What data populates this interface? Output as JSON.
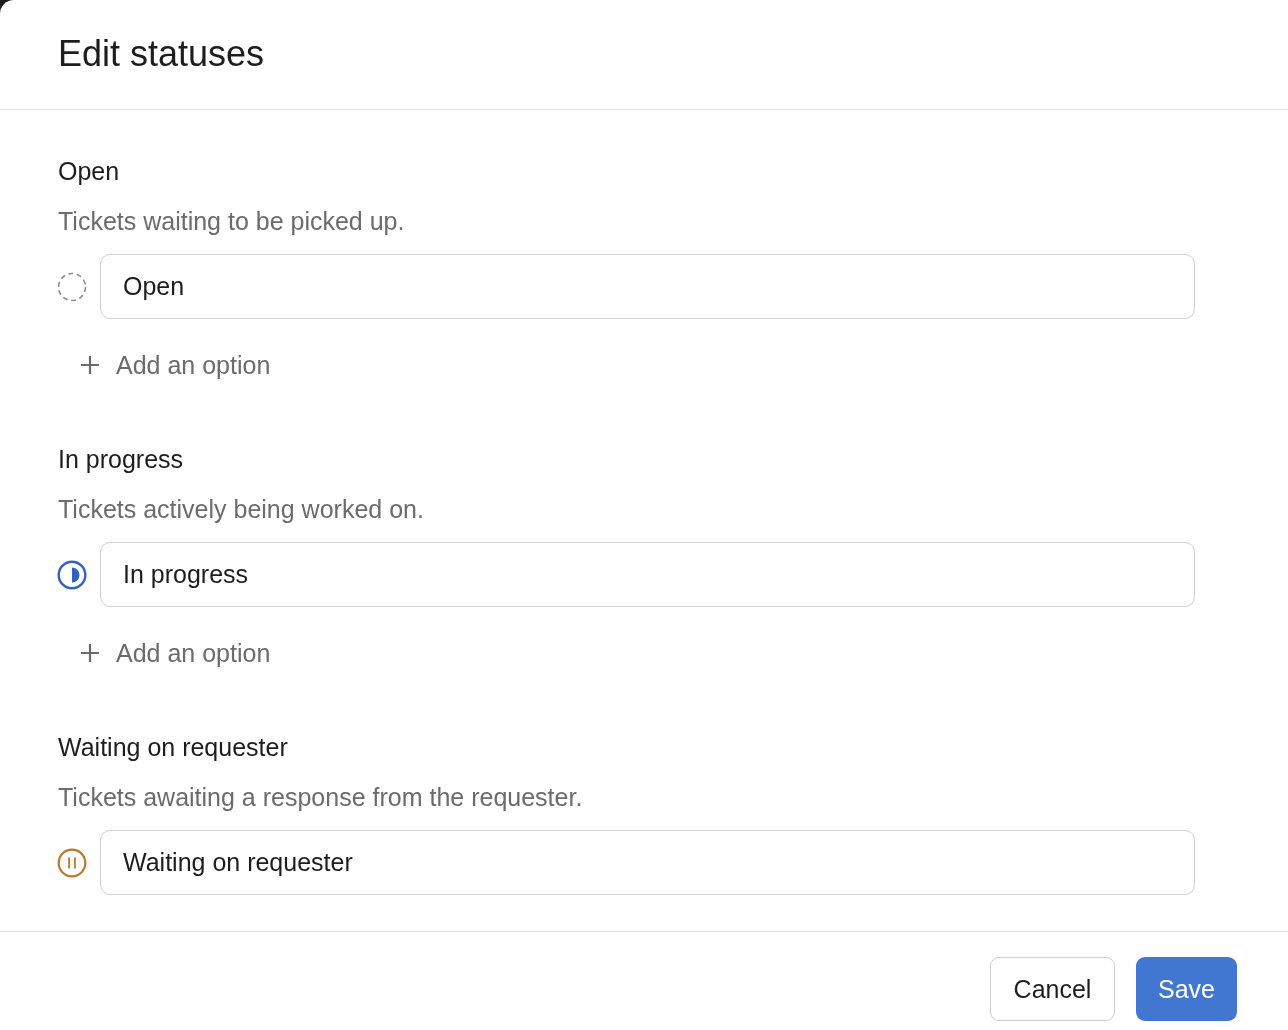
{
  "dialog": {
    "title": "Edit statuses"
  },
  "statuses": [
    {
      "label": "Open",
      "description": "Tickets waiting to be picked up.",
      "kind": "dashed",
      "color": "#8c8c8c",
      "value": "Open",
      "add_option": "Add an option"
    },
    {
      "label": "In progress",
      "description": "Tickets actively being worked on.",
      "kind": "half",
      "color": "#3160bf",
      "value": "In progress",
      "add_option": "Add an option"
    },
    {
      "label": "Waiting on requester",
      "description": "Tickets awaiting a response from the requester.",
      "kind": "paused",
      "color": "#b87a2e",
      "value": "Waiting on requester"
    }
  ],
  "footer": {
    "buttons": [
      {
        "label": "Cancel",
        "kind": "secondary"
      },
      {
        "label": "Save",
        "kind": "primary"
      }
    ]
  }
}
